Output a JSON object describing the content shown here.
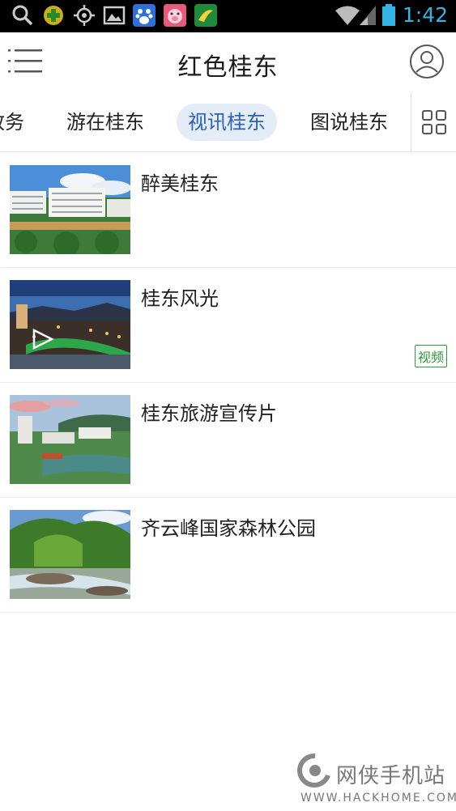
{
  "status_bar": {
    "time": "1:42",
    "icons": [
      "search-icon",
      "app-plus-icon",
      "locate-icon",
      "gallery-icon",
      "baidu-icon",
      "pig-app-icon",
      "green-app-icon",
      "wifi-icon",
      "signal-icon",
      "battery-icon"
    ]
  },
  "header": {
    "title": "红色桂东",
    "menu_icon": "menu-icon",
    "user_icon": "user-icon"
  },
  "tabs": [
    {
      "label": "政务"
    },
    {
      "label": "游在桂东"
    },
    {
      "label": "视讯桂东",
      "active": true
    },
    {
      "label": "图说桂东"
    }
  ],
  "grid_icon": "grid-icon",
  "items": [
    {
      "title": "醉美桂东",
      "video": false,
      "badge": ""
    },
    {
      "title": "桂东风光",
      "video": true,
      "badge": "视频"
    },
    {
      "title": "桂东旅游宣传片",
      "video": false,
      "badge": ""
    },
    {
      "title": "齐云峰国家森林公园",
      "video": false,
      "badge": ""
    }
  ],
  "watermark": {
    "name": "网侠手机站",
    "url": "WWW.HACKHOME.COM"
  },
  "colors": {
    "accent": "#2a61b8",
    "active_tab_bg": "#e4ecf8",
    "badge": "#2e9a3e",
    "time": "#33b5e5"
  }
}
